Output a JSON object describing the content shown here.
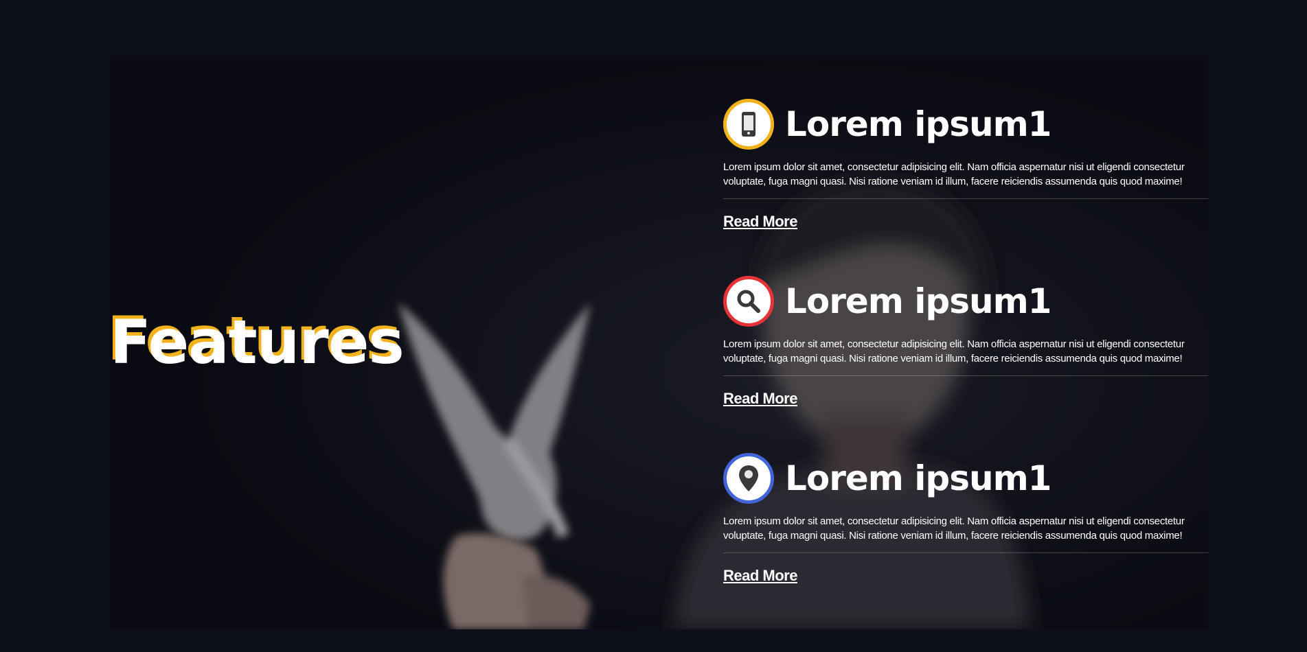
{
  "section": {
    "heading": "Features"
  },
  "features": [
    {
      "icon": "smartphone-icon",
      "accent": "#f2b21c",
      "title": "Lorem ipsum1",
      "text": "Lorem ipsum dolor sit amet, consectetur adipisicing elit. Nam officia aspernatur nisi ut eligendi consectetur voluptate, fuga magni quasi. Nisi ratione veniam id illum, facere reiciendis assumenda quis quod maxime!",
      "link": "Read More"
    },
    {
      "icon": "search-icon",
      "accent": "#e63338",
      "title": "Lorem ipsum1",
      "text": "Lorem ipsum dolor sit amet, consectetur adipisicing elit. Nam officia aspernatur nisi ut eligendi consectetur voluptate, fuga magni quasi. Nisi ratione veniam id illum, facere reiciendis assumenda quis quod maxime!",
      "link": "Read More"
    },
    {
      "icon": "location-pin-icon",
      "accent": "#4165d8",
      "title": "Lorem ipsum1",
      "text": "Lorem ipsum dolor sit amet, consectetur adipisicing elit. Nam officia aspernatur nisi ut eligendi consectetur voluptate, fuga magni quasi. Nisi ratione veniam id illum, facere reiciendis assumenda quis quod maxime!",
      "link": "Read More"
    }
  ]
}
